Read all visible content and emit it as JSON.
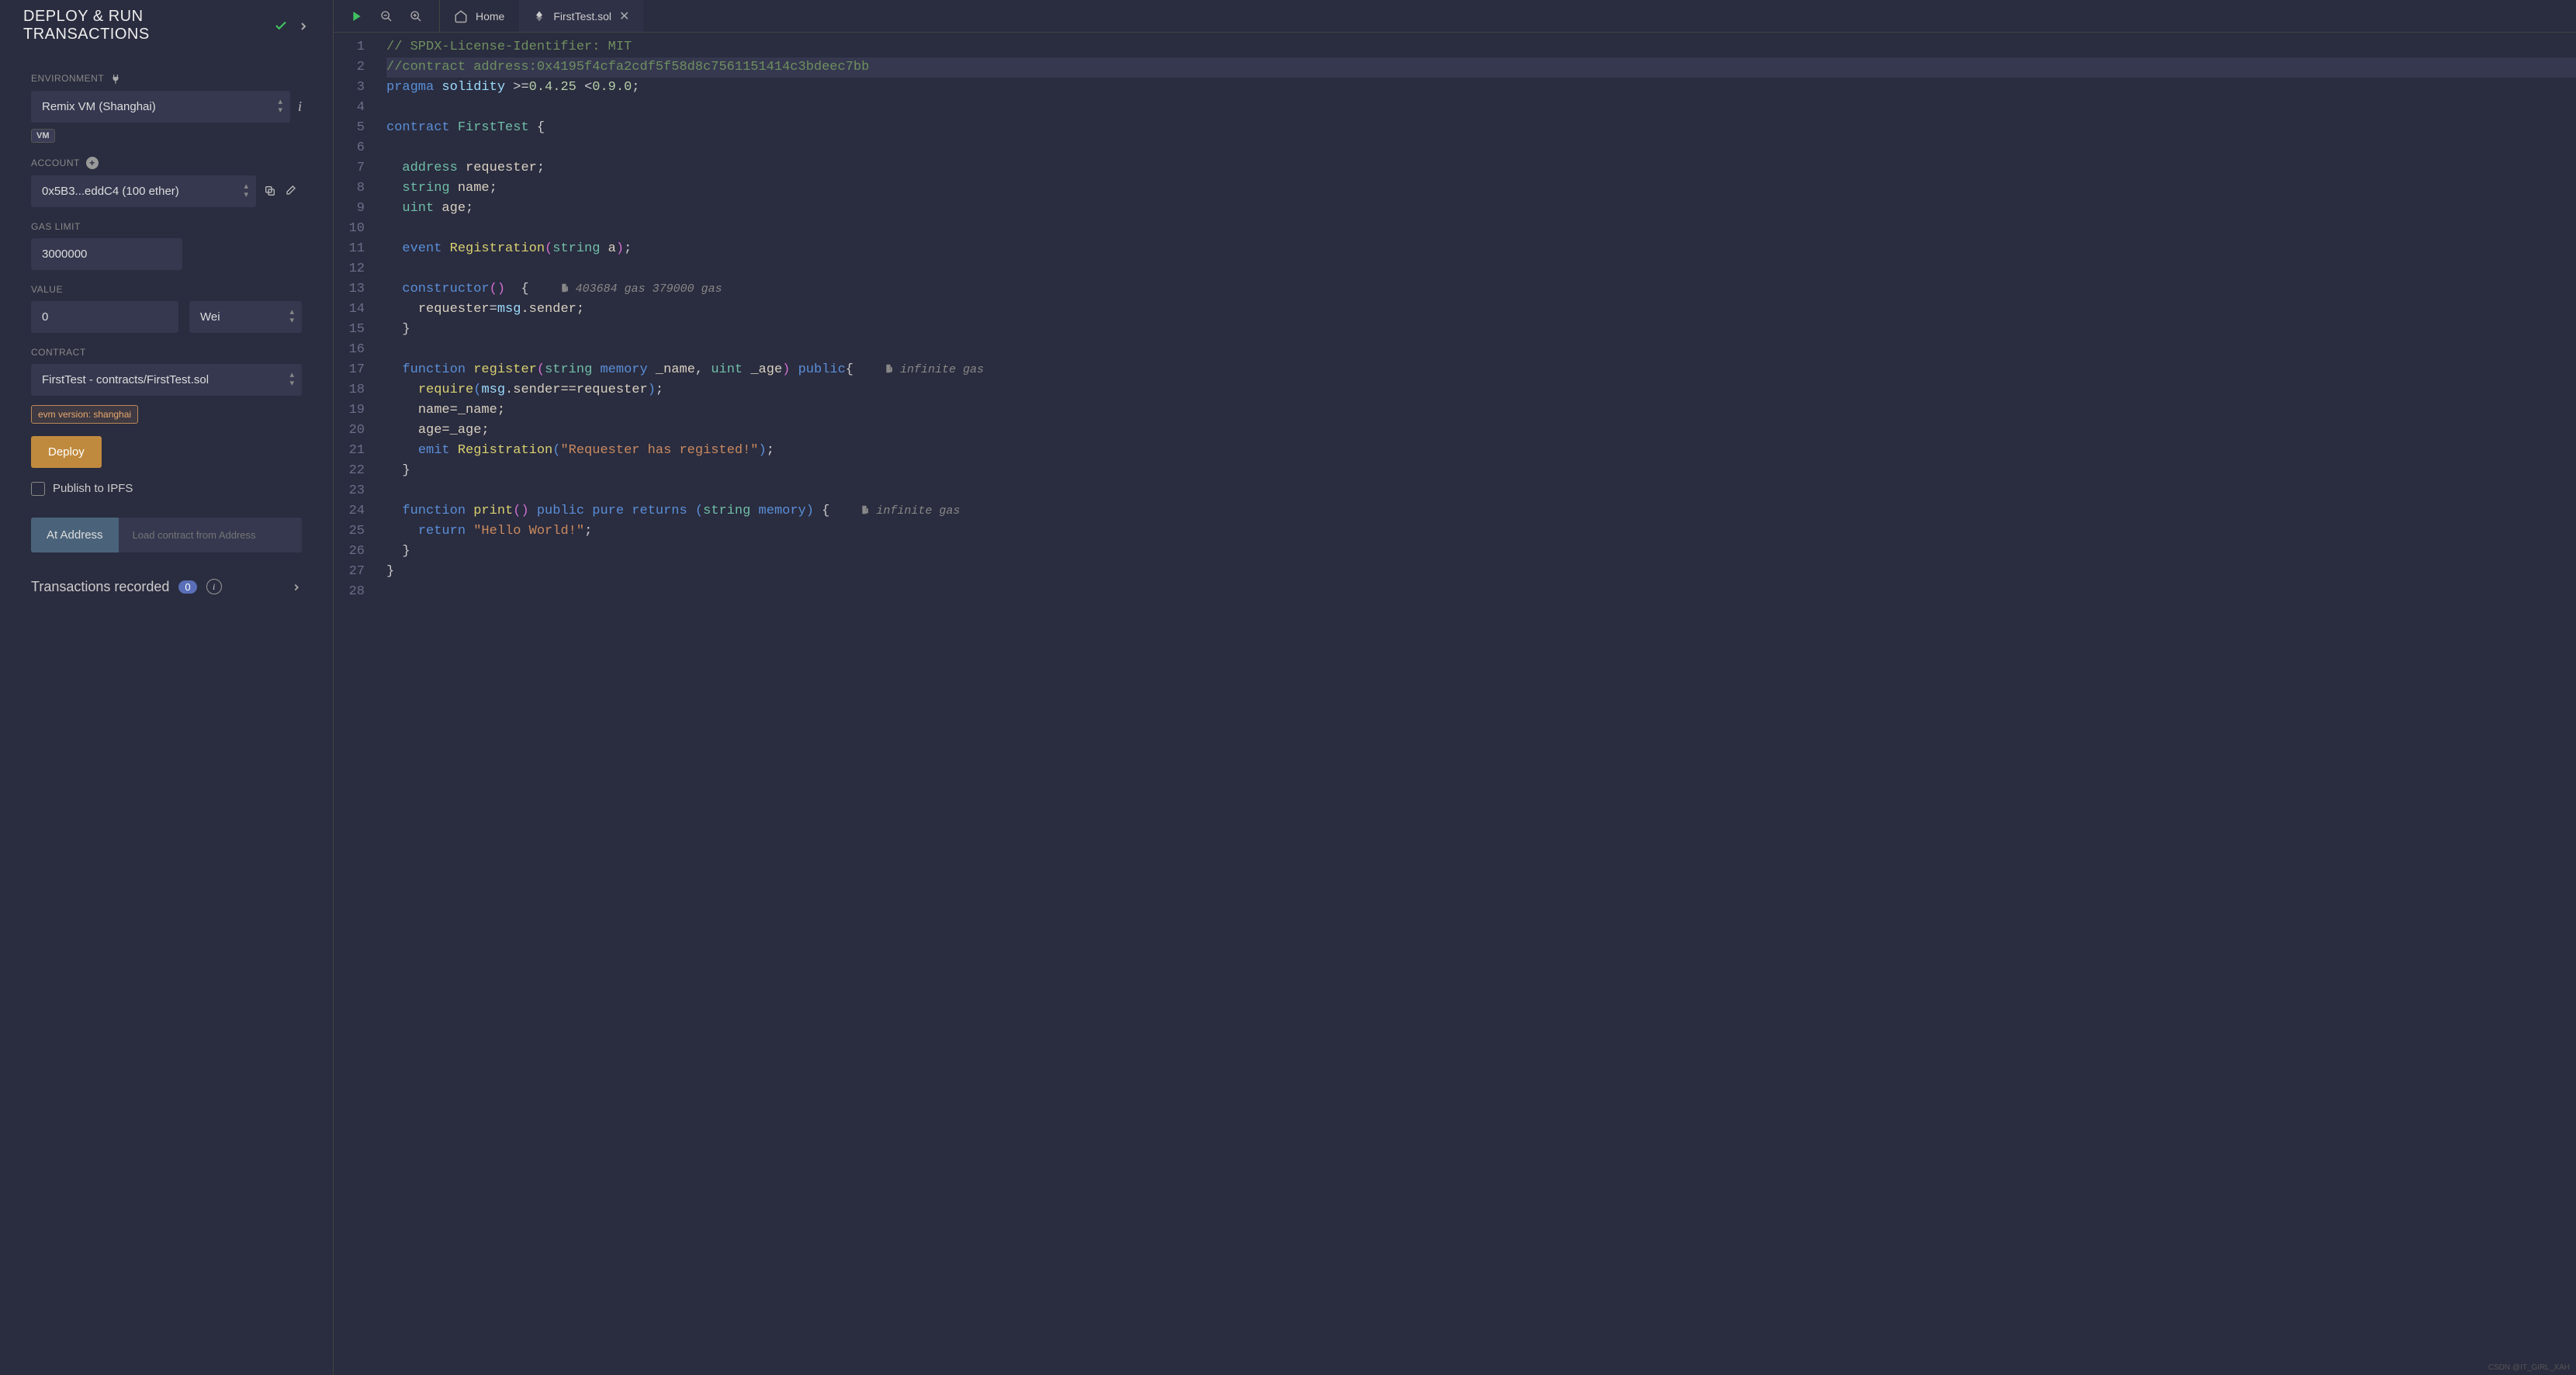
{
  "sidebar": {
    "title": "DEPLOY & RUN TRANSACTIONS",
    "environment_label": "ENVIRONMENT",
    "environment_value": "Remix VM (Shanghai)",
    "vm_badge": "VM",
    "account_label": "ACCOUNT",
    "account_value": "0x5B3...eddC4 (100 ether)",
    "gas_label": "GAS LIMIT",
    "gas_value": "3000000",
    "value_label": "VALUE",
    "value_amount": "0",
    "value_unit": "Wei",
    "contract_label": "CONTRACT",
    "contract_value": "FirstTest - contracts/FirstTest.sol",
    "evm_version": "evm version: shanghai",
    "deploy_label": "Deploy",
    "ipfs_label": "Publish to IPFS",
    "ataddress_label": "At Address",
    "ataddress_placeholder": "Load contract from Address",
    "tx_recorded_label": "Transactions recorded",
    "tx_count": "0"
  },
  "tabs": {
    "home": "Home",
    "file": "FirstTest.sol"
  },
  "gas": {
    "constructor": "403684 gas 379000 gas",
    "register": "infinite gas",
    "print": "infinite gas"
  },
  "code": {
    "l1": "// SPDX-License-Identifier: MIT",
    "l2": "//contract address:0x4195f4cfa2cdf5f58d8c7561151414c3bdeec7bb",
    "l3a": "pragma",
    "l3b": "solidity",
    "l3c": ">=",
    "l3d": "0.4.25",
    "l3e": "<",
    "l3f": "0.9.0",
    "l3g": ";",
    "l5a": "contract",
    "l5b": "FirstTest",
    "l5c": "{",
    "l7a": "address",
    "l7b": "requester",
    "l7c": ";",
    "l8a": "string",
    "l8b": "name",
    "l8c": ";",
    "l9a": "uint",
    "l9b": "age",
    "l9c": ";",
    "l11a": "event",
    "l11b": "Registration",
    "l11c": "(",
    "l11d": "string",
    "l11e": "a",
    "l11f": ")",
    "l11g": ";",
    "l13a": "constructor",
    "l13b": "()",
    "l13c": "{",
    "l14a": "requester",
    "l14b": "=",
    "l14c": "msg",
    "l14d": ".sender;",
    "l15a": "}",
    "l17a": "function",
    "l17b": "register",
    "l17c": "(",
    "l17d": "string",
    "l17e": "memory",
    "l17f": "_name",
    "l17g": ",",
    "l17h": "uint",
    "l17i": "_age",
    "l17j": ")",
    "l17k": "public",
    "l17l": "{",
    "l18a": "require",
    "l18b": "(",
    "l18c": "msg",
    "l18d": ".sender==requester",
    "l18e": ")",
    "l18f": ";",
    "l19a": "name=_name;",
    "l20a": "age=_age;",
    "l21a": "emit",
    "l21b": "Registration",
    "l21c": "(",
    "l21d": "\"Requester has registed!\"",
    "l21e": ")",
    "l21f": ";",
    "l22a": "}",
    "l24a": "function",
    "l24b": "print",
    "l24c": "()",
    "l24d": "public",
    "l24e": "pure",
    "l24f": "returns",
    "l24g": "(",
    "l24h": "string",
    "l24i": "memory",
    "l24j": ")",
    "l24k": "{",
    "l25a": "return",
    "l25b": "\"Hello World!\"",
    "l25c": ";",
    "l26a": "}",
    "l27a": "}"
  },
  "watermark": "CSDN @IT_GIRL_XAH"
}
